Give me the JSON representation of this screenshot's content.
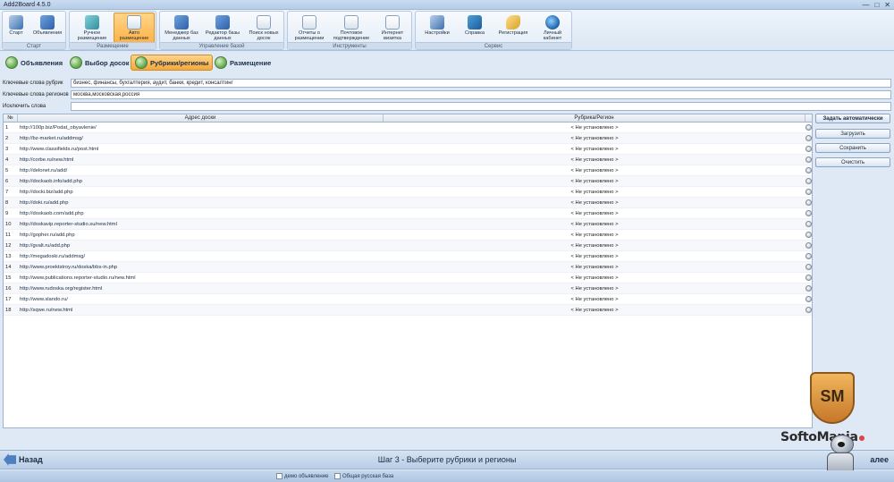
{
  "window": {
    "title": "Add2Board 4.5.0",
    "controls": [
      "—",
      "□",
      "✕"
    ]
  },
  "ribbon": {
    "groups": [
      {
        "label": "Старт",
        "buttons": [
          {
            "label": "Старт",
            "icon": "wand-icon"
          },
          {
            "label": "Объявления",
            "icon": "megaphone-icon"
          }
        ]
      },
      {
        "label": "Размещение",
        "buttons": [
          {
            "label": "Ручное размещение",
            "icon": "hand-icon"
          },
          {
            "label": "Авто размещение",
            "icon": "auto-icon",
            "active": true
          }
        ]
      },
      {
        "label": "Управление базой",
        "buttons": [
          {
            "label": "Менеджер баз данных",
            "icon": "database-icon"
          },
          {
            "label": "Редактор базы данных",
            "icon": "db-editor-icon"
          },
          {
            "label": "Поиск новых досок",
            "icon": "search-boards-icon"
          }
        ]
      },
      {
        "label": "Инструменты",
        "buttons": [
          {
            "label": "Отчеты о размещении",
            "icon": "report-icon"
          },
          {
            "label": "Почтовое подтверждение",
            "icon": "mail-icon"
          },
          {
            "label": "Интернет визитка",
            "icon": "card-icon"
          }
        ]
      },
      {
        "label": "Сервис",
        "buttons": [
          {
            "label": "Настройки",
            "icon": "settings-icon"
          },
          {
            "label": "Справка",
            "icon": "help-book-icon"
          },
          {
            "label": "Регистрация",
            "icon": "key-icon"
          },
          {
            "label": "Личный кабинет",
            "icon": "globe-icon"
          }
        ]
      }
    ]
  },
  "steps": [
    {
      "label": "Объявления",
      "active": false
    },
    {
      "label": "Выбор досок",
      "active": false
    },
    {
      "label": "Рубрики/регионы",
      "active": true
    },
    {
      "label": "Размещение",
      "active": false
    }
  ],
  "keywords": {
    "rubrics_label": "Ключевые слова рубрик",
    "rubrics_value": "бизнес, финансы, бухгалтерия, аудит, банки, кредит, консалтинг",
    "regions_label": "Ключевые слова регионов",
    "regions_value": "москва,московская,россия",
    "exclude_label": "Исключить слова",
    "exclude_value": ""
  },
  "grid": {
    "headers": {
      "num": "№",
      "url": "Адрес доски",
      "category": "Рубрика/Регион"
    },
    "rows": [
      {
        "num": "1",
        "url": "http://100p.biz/Podat_obyavlenie/",
        "category": "< Не установлено >"
      },
      {
        "num": "2",
        "url": "http://bz-market.ru/addmsg/",
        "category": "< Не установлено >"
      },
      {
        "num": "3",
        "url": "http://www.classifields.ru/post.html",
        "category": "< Не установлено >"
      },
      {
        "num": "4",
        "url": "http://corbe.ru/new.html",
        "category": "< Не установлено >"
      },
      {
        "num": "5",
        "url": "http://delonet.ru/add/",
        "category": "< Не установлено >"
      },
      {
        "num": "6",
        "url": "http://dockaob.info/add.php",
        "category": "< Не установлено >"
      },
      {
        "num": "7",
        "url": "http://docki.biz/add.php",
        "category": "< Не установлено >"
      },
      {
        "num": "8",
        "url": "http://doki.ru/add.php",
        "category": "< Не установлено >"
      },
      {
        "num": "9",
        "url": "http://doskaob.com/add.php",
        "category": "< Не установлено >"
      },
      {
        "num": "10",
        "url": "http://doskavip.reporter-studio.su/new.html",
        "category": "< Не установлено >"
      },
      {
        "num": "11",
        "url": "http://gopher.ru/add.php",
        "category": "< Не установлено >"
      },
      {
        "num": "12",
        "url": "http://gvalt.ru/add.php",
        "category": "< Не установлено >"
      },
      {
        "num": "13",
        "url": "http://megadoski.ru/addmsg/",
        "category": "< Не установлено >"
      },
      {
        "num": "14",
        "url": "http://www.proektstroy.ru/doska/bbs-in.php",
        "category": "< Не установлено >"
      },
      {
        "num": "15",
        "url": "http://www.publications.reporter-studio.ru/new.html",
        "category": "< Не установлено >"
      },
      {
        "num": "16",
        "url": "http://www.rudoska.org/register.html",
        "category": "< Не установлено >"
      },
      {
        "num": "17",
        "url": "http://www.slando.ru/",
        "category": "< Не установлено >"
      },
      {
        "num": "18",
        "url": "http://sqwe.ru/new.html",
        "category": "< Не установлено >"
      }
    ]
  },
  "side_buttons": {
    "auto": "Задать автоматически",
    "load": "Загрузить",
    "save": "Сохранить",
    "clear": "Очистить"
  },
  "watermark": {
    "badge": "SM",
    "text": "SoftoMania"
  },
  "nav": {
    "back": "Назад",
    "step": "Шаг 3 - Выберите рубрики и регионы",
    "next": "алее"
  },
  "status": {
    "item1": "демо объявление",
    "item2": "Общая русская база"
  }
}
